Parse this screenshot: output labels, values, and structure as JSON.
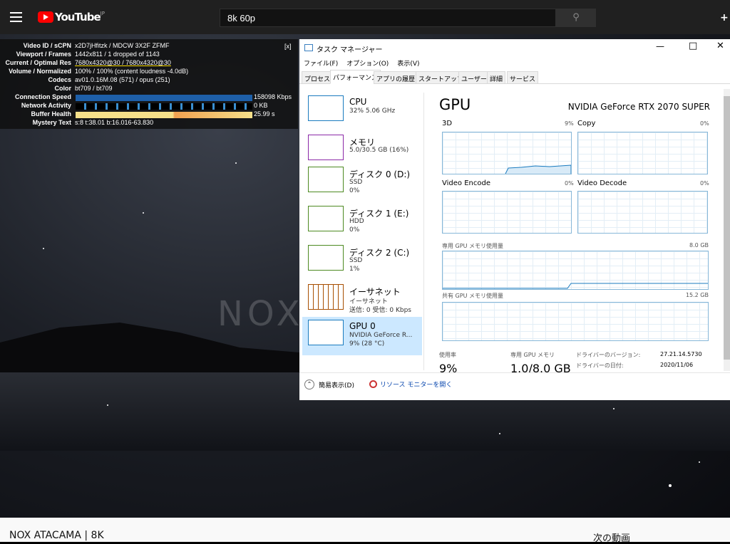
{
  "youtube": {
    "logo": "YouTube",
    "region": "JP",
    "search_value": "8k 60p",
    "video_title": "NOX ATACAMA | 8K",
    "next_label": "次の動画",
    "watermark": "NOX"
  },
  "stats": {
    "close": "[x]",
    "rows": [
      {
        "k": "Video ID / sCPN",
        "v": "x2D7jHfitzk / MDCW 3X2F ZFMF"
      },
      {
        "k": "Viewport / Frames",
        "v": "1442x811 / 1 dropped of 1143"
      },
      {
        "k": "Current / Optimal Res",
        "v": "7680x4320@30 / 7680x4320@30"
      },
      {
        "k": "Volume / Normalized",
        "v": "100% / 100% (content loudness -4.0dB)"
      },
      {
        "k": "Codecs",
        "v": "av01.0.16M.08 (571) / opus (251)"
      },
      {
        "k": "Color",
        "v": "bt709 / bt709"
      },
      {
        "k": "Connection Speed",
        "v": "158098 Kbps"
      },
      {
        "k": "Network Activity",
        "v": "0 KB"
      },
      {
        "k": "Buffer Health",
        "v": "25.99 s"
      },
      {
        "k": "Mystery Text",
        "v": "s:8 t:38.01 b:16.016-63.830"
      }
    ]
  },
  "tm": {
    "title": "タスク マネージャー",
    "menu": [
      "ファイル(F)",
      "オプション(O)",
      "表示(V)"
    ],
    "tabs": [
      "プロセス",
      "パフォーマンス",
      "アプリの履歴",
      "スタートアップ",
      "ユーザー",
      "詳細",
      "サービス"
    ],
    "items": [
      {
        "title": "CPU",
        "sub1": "32%  5.06 GHz",
        "sub2": "",
        "color": "#1a7bbf"
      },
      {
        "title": "メモリ",
        "sub1": "5.0/30.5 GB (16%)",
        "sub2": "",
        "color": "#8b28a7"
      },
      {
        "title": "ディスク 0 (D:)",
        "sub1": "SSD",
        "sub2": "0%",
        "color": "#4d8a21"
      },
      {
        "title": "ディスク 1 (E:)",
        "sub1": "HDD",
        "sub2": "0%",
        "color": "#4d8a21"
      },
      {
        "title": "ディスク 2 (C:)",
        "sub1": "SSD",
        "sub2": "1%",
        "color": "#4d8a21"
      },
      {
        "title": "イーサネット",
        "sub1": "イーサネット",
        "sub2": "送信: 0 受信: 0 Kbps",
        "color": "#a74f01"
      },
      {
        "title": "GPU 0",
        "sub1": "NVIDIA GeForce R...",
        "sub2": "9% (28 °C)",
        "color": "#1a7bbf"
      }
    ],
    "gpu": {
      "heading": "GPU",
      "name": "NVIDIA GeForce RTX 2070 SUPER",
      "engines": [
        {
          "name": "3D",
          "pct": "9%"
        },
        {
          "name": "Copy",
          "pct": "0%"
        },
        {
          "name": "Video Encode",
          "pct": "0%"
        },
        {
          "name": "Video Decode",
          "pct": "0%"
        }
      ],
      "dedicated_label": "専用 GPU メモリ使用量",
      "dedicated_max": "8.0 GB",
      "shared_label": "共有 GPU メモリ使用量",
      "shared_max": "15.2 GB",
      "usage_label": "使用率",
      "usage_value": "9%",
      "mem_label": "専用 GPU メモリ",
      "mem_value": "1.0/8.0 GB",
      "driver_ver_label": "ドライバーのバージョン:",
      "driver_ver": "27.21.14.5730",
      "driver_date_label": "ドライバーの日付:",
      "driver_date": "2020/11/06"
    },
    "fewer_details": "簡易表示(D)",
    "resmon": "リソース モニターを開く"
  }
}
